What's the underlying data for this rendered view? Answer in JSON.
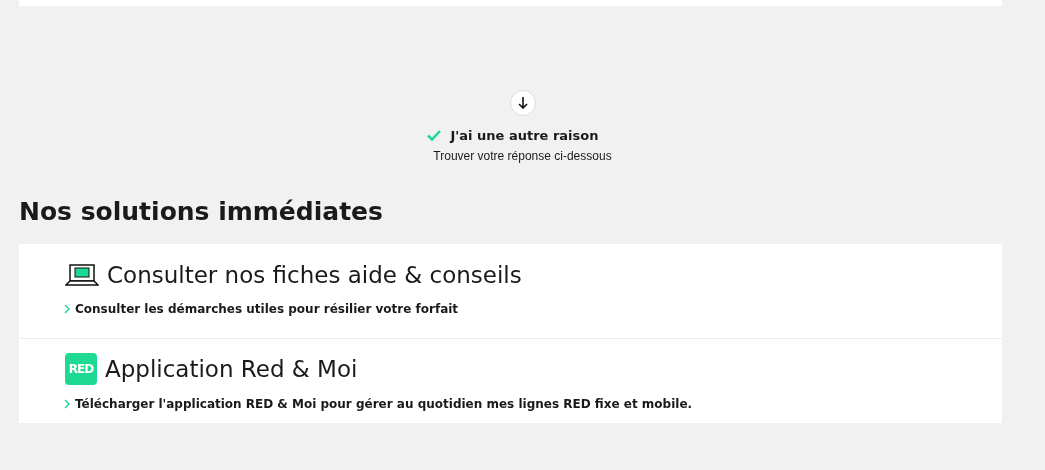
{
  "reason": {
    "title": "J'ai une autre raison",
    "subtitle": "Trouver votre réponse ci-dessous"
  },
  "section": {
    "title": "Nos solutions immédiates"
  },
  "solutions": [
    {
      "kind": "laptop",
      "title": "Consulter nos fiches aide & conseils",
      "link": "Consulter les démarches utiles pour résilier votre forfait"
    },
    {
      "kind": "app",
      "logo_text": "RED",
      "title": "Application Red & Moi",
      "link": "Télécharger l'application RED & Moi pour gérer au quotidien mes lignes RED fixe et mobile."
    }
  ]
}
